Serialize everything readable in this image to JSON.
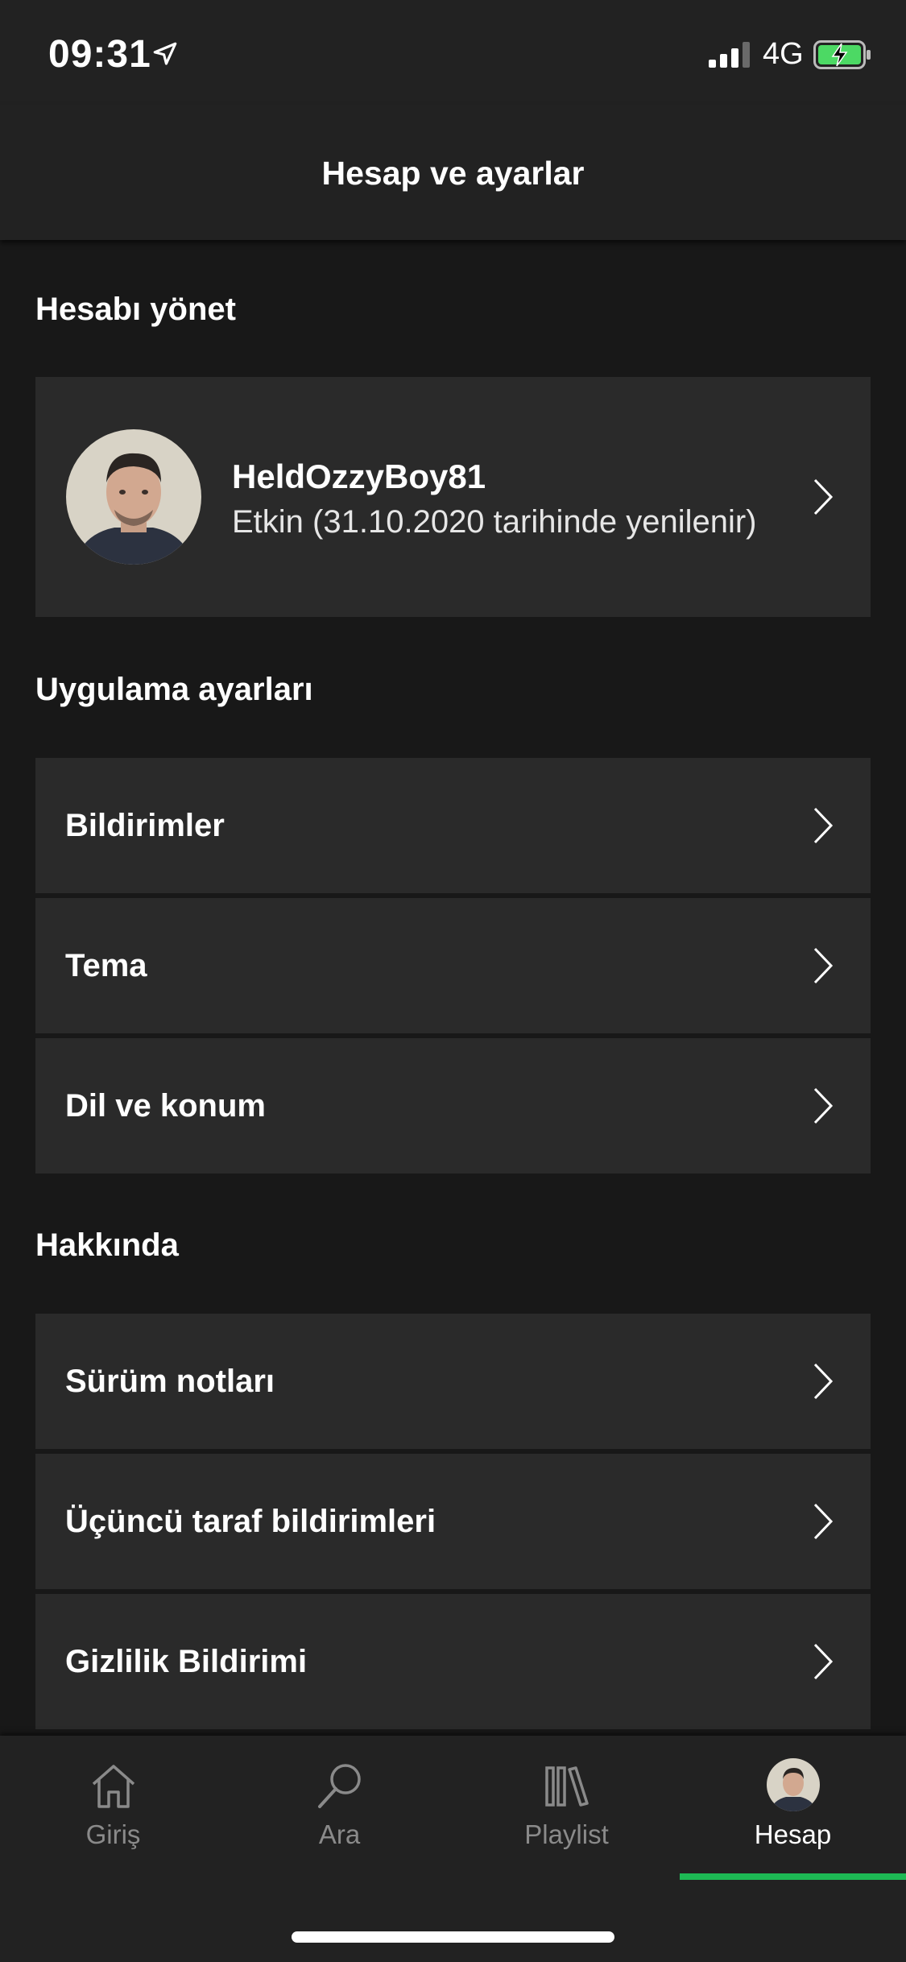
{
  "status_bar": {
    "time": "09:31",
    "network": "4G",
    "icons": [
      "location-arrow-icon",
      "signal-bars-icon",
      "battery-charging-icon"
    ]
  },
  "header": {
    "title": "Hesap ve ayarlar"
  },
  "sections": {
    "manage": {
      "title": "Hesabı yönet",
      "profile": {
        "username": "HeldOzzyBoy81",
        "subscription": "Etkin (31.10.2020 tarihinde yenilenir)"
      }
    },
    "app_settings": {
      "title": "Uygulama ayarları",
      "items": [
        {
          "label": "Bildirimler"
        },
        {
          "label": "Tema"
        },
        {
          "label": "Dil ve konum"
        }
      ]
    },
    "about": {
      "title": "Hakkında",
      "items": [
        {
          "label": "Sürüm notları"
        },
        {
          "label": "Üçüncü taraf bildirimleri"
        },
        {
          "label": "Gizlilik Bildirimi"
        }
      ]
    }
  },
  "tabbar": {
    "tabs": [
      {
        "label": "Giriş",
        "icon": "home-icon"
      },
      {
        "label": "Ara",
        "icon": "search-icon"
      },
      {
        "label": "Playlist",
        "icon": "library-icon"
      },
      {
        "label": "Hesap",
        "icon": "avatar-icon",
        "active": true
      }
    ],
    "accent_color": "#1db954"
  },
  "colors": {
    "background": "#181818",
    "card": "#2a2a2a",
    "bar": "#222222"
  }
}
